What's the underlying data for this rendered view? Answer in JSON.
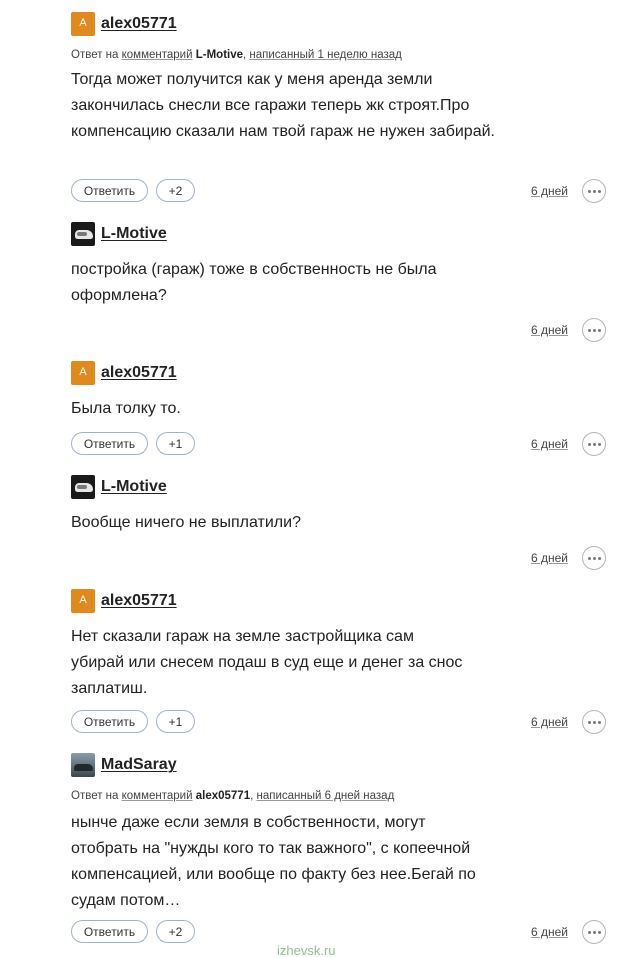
{
  "comments": [
    {
      "author": "alex05771",
      "avatar_letter": "A",
      "reply_prefix": "Ответ на",
      "reply_link": "комментарий",
      "reply_author": "L-Motive",
      "reply_suffix": "написанный 1 неделю назад",
      "text": "Тогда может получится как у меня аренда земли закончилась снесли все гаражи теперь жк строят.Про компенсацию сказали нам твой гараж не нужен забирай.",
      "reply_button": "Ответить",
      "votes": "+2",
      "time": "6 дней"
    },
    {
      "author": "L-Motive",
      "text": "постройка (гараж) тоже в собственность не была оформлена?",
      "time": "6 дней"
    },
    {
      "author": "alex05771",
      "avatar_letter": "A",
      "text": "Была толку то.",
      "reply_button": "Ответить",
      "votes": "+1",
      "time": "6 дней"
    },
    {
      "author": "L-Motive",
      "text": "Вообще ничего не выплатили?",
      "time": "6 дней"
    },
    {
      "author": "alex05771",
      "avatar_letter": "A",
      "text": "Нет сказали гараж на земле застройщика сам убирай или снесем подаш в суд еще и денег за снос заплатиш.",
      "reply_button": "Ответить",
      "votes": "+1",
      "time": "6 дней"
    },
    {
      "author": "MadSaray",
      "reply_prefix": "Ответ на",
      "reply_link": "комментарий",
      "reply_author": "alex05771",
      "reply_suffix": "написанный 6 дней назад",
      "text": "нынче даже если земля в собственности, могут отобрать на \"нужды кого то так важного\", с копеечной компенсацией, или вообще по факту без нее.Бегай по судам потом…",
      "reply_button": "Ответить",
      "votes": "+2",
      "time": "6 дней"
    }
  ],
  "watermark": "izhevsk.ru"
}
